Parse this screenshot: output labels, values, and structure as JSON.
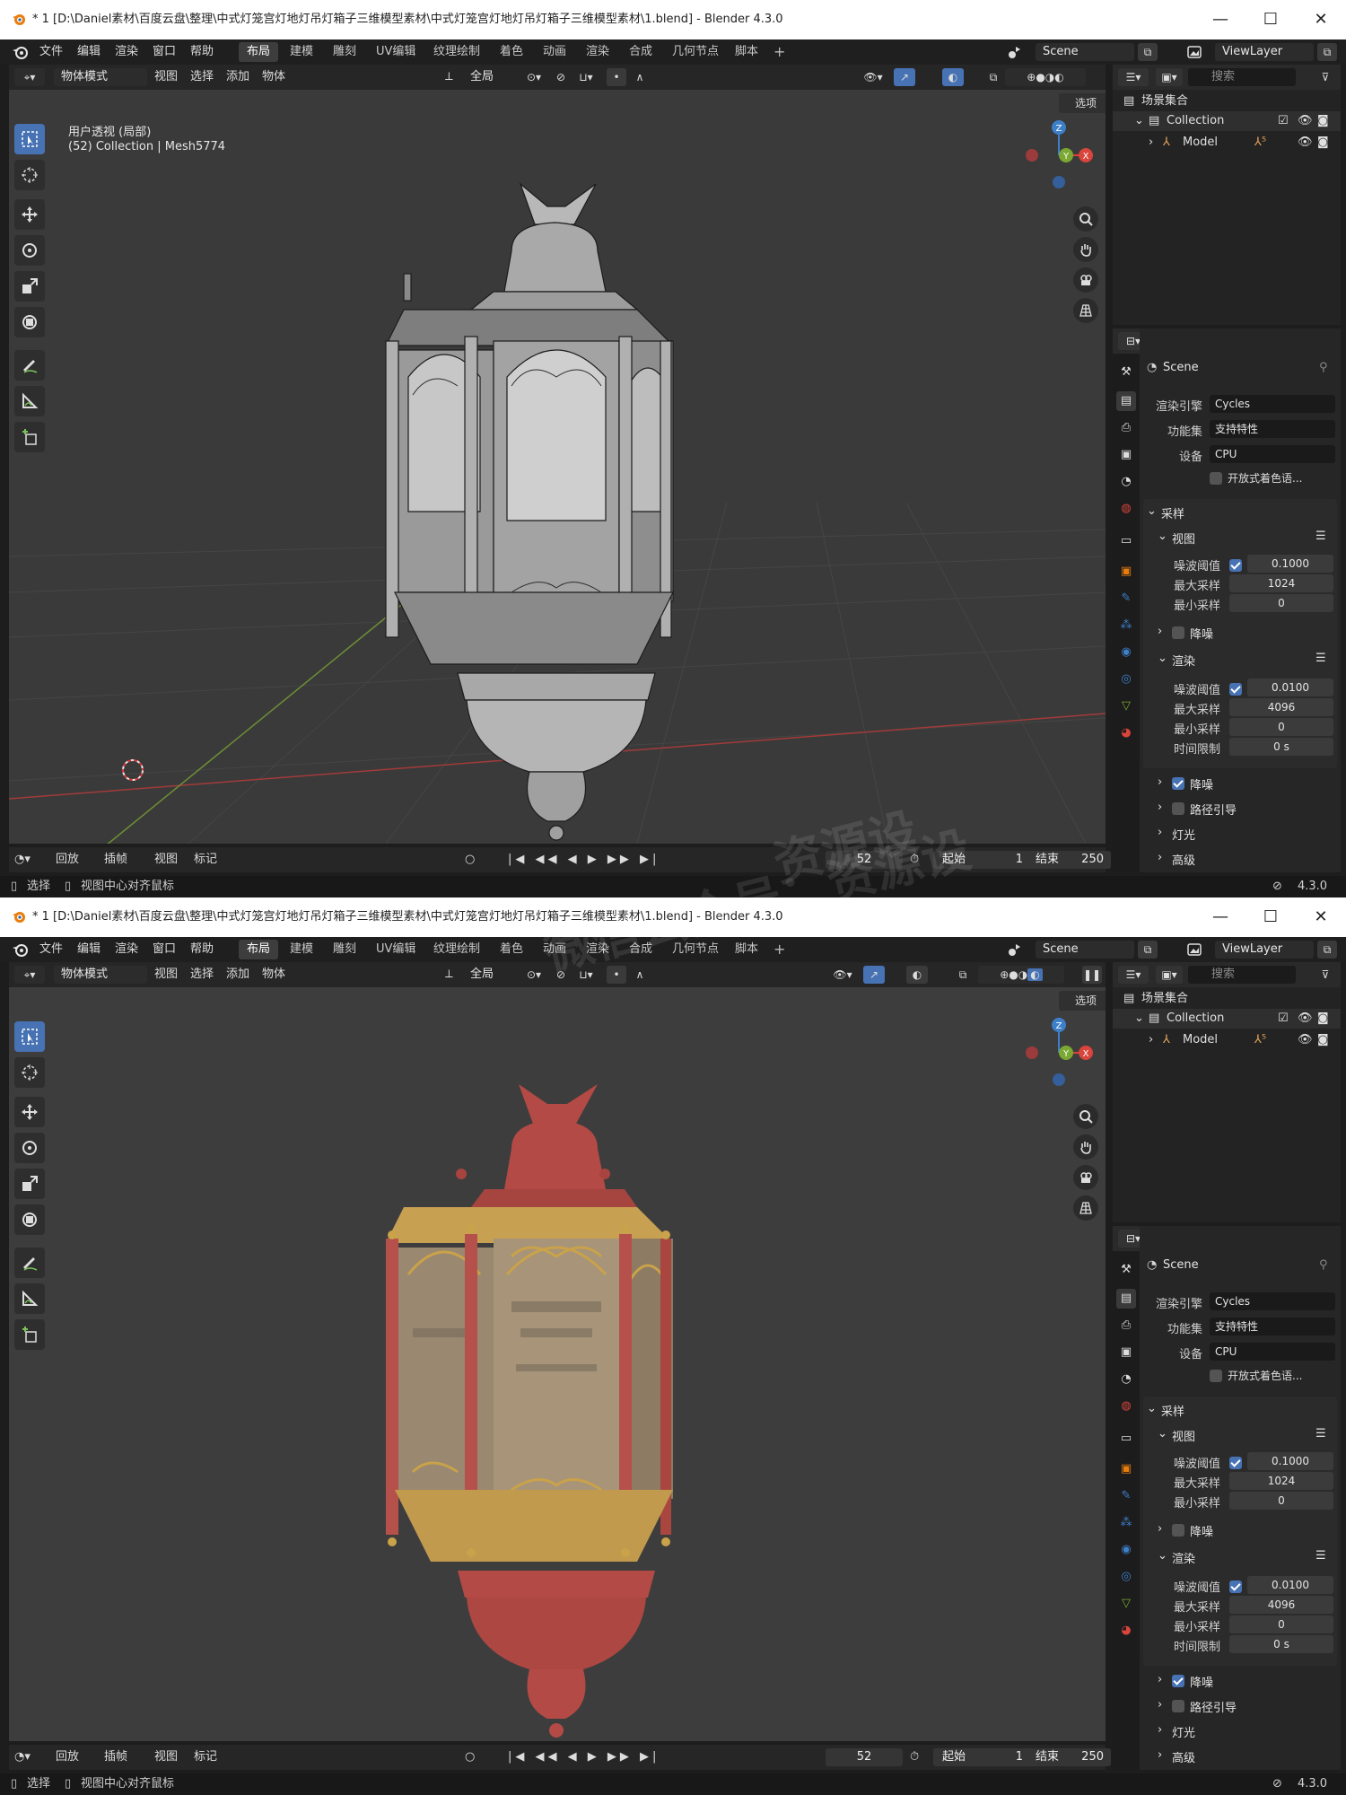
{
  "windows": [
    {
      "id": "w1",
      "shading": "wireframe",
      "titlebar": {
        "title": "* 1 [D:\\Daniel素材\\百度云盘\\整理\\中式灯笼宫灯地灯吊灯箱子三维模型素材\\中式灯笼宫灯地灯吊灯箱子三维模型素材\\1.blend] - Blender 4.3.0",
        "minimize": "—",
        "maximize": "☐",
        "close": "✕"
      },
      "menus": [
        "文件",
        "编辑",
        "渲染",
        "窗口",
        "帮助"
      ],
      "workspaces": [
        "布局",
        "建模",
        "雕刻",
        "UV编辑",
        "纹理绘制",
        "着色",
        "动画",
        "渲染",
        "合成",
        "几何节点",
        "脚本"
      ],
      "active_workspace": "布局",
      "plus": "+",
      "scene": "Scene",
      "view_layer": "ViewLayer",
      "viewport_header": {
        "mode": "物体模式",
        "items": [
          "视图",
          "选择",
          "添加",
          "物体"
        ],
        "transform": "全局"
      },
      "viewport": {
        "line1": "用户透视 (局部)",
        "line2": "(52) Collection | Mesh5774",
        "options": "选项"
      },
      "gizmo": {
        "z": "Z",
        "x": "X",
        "y": "Y"
      },
      "timeline": {
        "playback": "回放",
        "keying": "插帧",
        "view": "视图",
        "marker": "标记",
        "current_frame": "52",
        "start_label": "起始",
        "start": "1",
        "end_label": "结束",
        "end": "250"
      },
      "status": {
        "select": "选择",
        "center": "视图中心对齐鼠标",
        "version": "4.3.0"
      },
      "outliner": {
        "search": "搜索",
        "scene_collection": "场景集合",
        "collection": "Collection",
        "model": "Model"
      },
      "properties": {
        "search": "搜索",
        "scene": "Scene",
        "render_engine_label": "渲染引擎",
        "render_engine": "Cycles",
        "feature_set_label": "功能集",
        "feature_set": "支持特性",
        "device_label": "设备",
        "device": "CPU",
        "osl": "开放式着色语...",
        "sampling": "采样",
        "viewport": "视图",
        "v_noise_label": "噪波阈值",
        "v_noise": "0.1000",
        "v_max_label": "最大采样",
        "v_max": "1024",
        "v_min_label": "最小采样",
        "v_min": "0",
        "v_denoise": "降噪",
        "render": "渲染",
        "r_noise_label": "噪波阈值",
        "r_noise": "0.0100",
        "r_max_label": "最大采样",
        "r_max": "4096",
        "r_min_label": "最小采样",
        "r_min": "0",
        "r_time_label": "时间限制",
        "r_time": "0 s",
        "r_denoise": "降噪",
        "path_guiding": "路径引导",
        "lights": "灯光",
        "advanced": "高级"
      }
    },
    {
      "id": "w2",
      "shading": "material",
      "titlebar": {
        "title": "* 1 [D:\\Daniel素材\\百度云盘\\整理\\中式灯笼宫灯地灯吊灯箱子三维模型素材\\中式灯笼宫灯地灯吊灯箱子三维模型素材\\1.blend] - Blender 4.3.0",
        "minimize": "—",
        "maximize": "☐",
        "close": "✕"
      },
      "menus": [
        "文件",
        "编辑",
        "渲染",
        "窗口",
        "帮助"
      ],
      "workspaces": [
        "布局",
        "建模",
        "雕刻",
        "UV编辑",
        "纹理绘制",
        "着色",
        "动画",
        "渲染",
        "合成",
        "几何节点",
        "脚本"
      ],
      "active_workspace": "布局",
      "plus": "+",
      "scene": "Scene",
      "view_layer": "ViewLayer",
      "viewport_header": {
        "mode": "物体模式",
        "items": [
          "视图",
          "选择",
          "添加",
          "物体"
        ],
        "transform": "全局"
      },
      "viewport": {
        "line1": "",
        "line2": "",
        "options": "选项"
      },
      "gizmo": {
        "z": "Z",
        "x": "X",
        "y": "Y"
      },
      "timeline": {
        "playback": "回放",
        "keying": "插帧",
        "view": "视图",
        "marker": "标记",
        "current_frame": "52",
        "start_label": "起始",
        "start": "1",
        "end_label": "结束",
        "end": "250"
      },
      "status": {
        "select": "选择",
        "center": "视图中心对齐鼠标",
        "version": "4.3.0"
      },
      "outliner": {
        "search": "搜索",
        "scene_collection": "场景集合",
        "collection": "Collection",
        "model": "Model"
      },
      "properties": {
        "search": "搜索",
        "scene": "Scene",
        "render_engine_label": "渲染引擎",
        "render_engine": "Cycles",
        "feature_set_label": "功能集",
        "feature_set": "支持特性",
        "device_label": "设备",
        "device": "CPU",
        "osl": "开放式着色语...",
        "sampling": "采样",
        "viewport": "视图",
        "v_noise_label": "噪波阈值",
        "v_noise": "0.1000",
        "v_max_label": "最大采样",
        "v_max": "1024",
        "v_min_label": "最小采样",
        "v_min": "0",
        "v_denoise": "降噪",
        "render": "渲染",
        "r_noise_label": "噪波阈值",
        "r_noise": "0.0100",
        "r_max_label": "最大采样",
        "r_max": "4096",
        "r_min_label": "最小采样",
        "r_min": "0",
        "r_time_label": "时间限制",
        "r_time": "0 s",
        "r_denoise": "降噪",
        "path_guiding": "路径引导",
        "lights": "灯光",
        "advanced": "高级"
      }
    }
  ],
  "watermark": [
    "微信公众号：资源设",
    "资源设"
  ],
  "colors": {
    "accent": "#4772b3",
    "x_axis": "#d9443c",
    "y_axis": "#7aa832",
    "z_axis": "#3d7fc9",
    "lantern_red": "#b34a45",
    "lantern_gold": "#c9a24a"
  },
  "icons": [
    "blender-logo-icon",
    "select-box-icon",
    "cursor-icon",
    "move-icon",
    "rotate-icon",
    "scale-icon",
    "transform-icon",
    "annotate-icon",
    "measure-icon",
    "add-cube-icon",
    "zoom-icon",
    "hand-icon",
    "camera-icon",
    "grid-icon",
    "eye-icon",
    "camera-render-icon",
    "checkbox-icon",
    "pin-icon",
    "filter-icon",
    "play-icon",
    "stopwatch-icon"
  ]
}
